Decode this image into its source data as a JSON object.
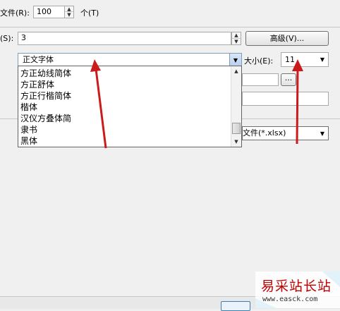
{
  "top_row": {
    "label": "文件(R):",
    "value": "100",
    "unit": "个(T)"
  },
  "row2": {
    "label": "(S):",
    "value": "3",
    "advanced_button": "高级(V)..."
  },
  "font_combo": {
    "value": "正文字体"
  },
  "size": {
    "label": "大小(E):",
    "value": "11"
  },
  "browse_button": "...",
  "format_combo": {
    "value": "文件(*.xlsx)"
  },
  "dropdown_items": [
    "方正幼线简体",
    "方正舒体",
    "方正行楷简体",
    "楷体",
    "汉仪方叠体简",
    "隶书",
    "黑体"
  ],
  "scrollbar": {
    "position": 0.85
  },
  "watermark": {
    "title": "易采站长站",
    "url": "www.easck.com"
  },
  "colors": {
    "arrow": "#cc1a1a",
    "watermark_text": "#c00000",
    "watermark_corner": "#39a7e0"
  }
}
